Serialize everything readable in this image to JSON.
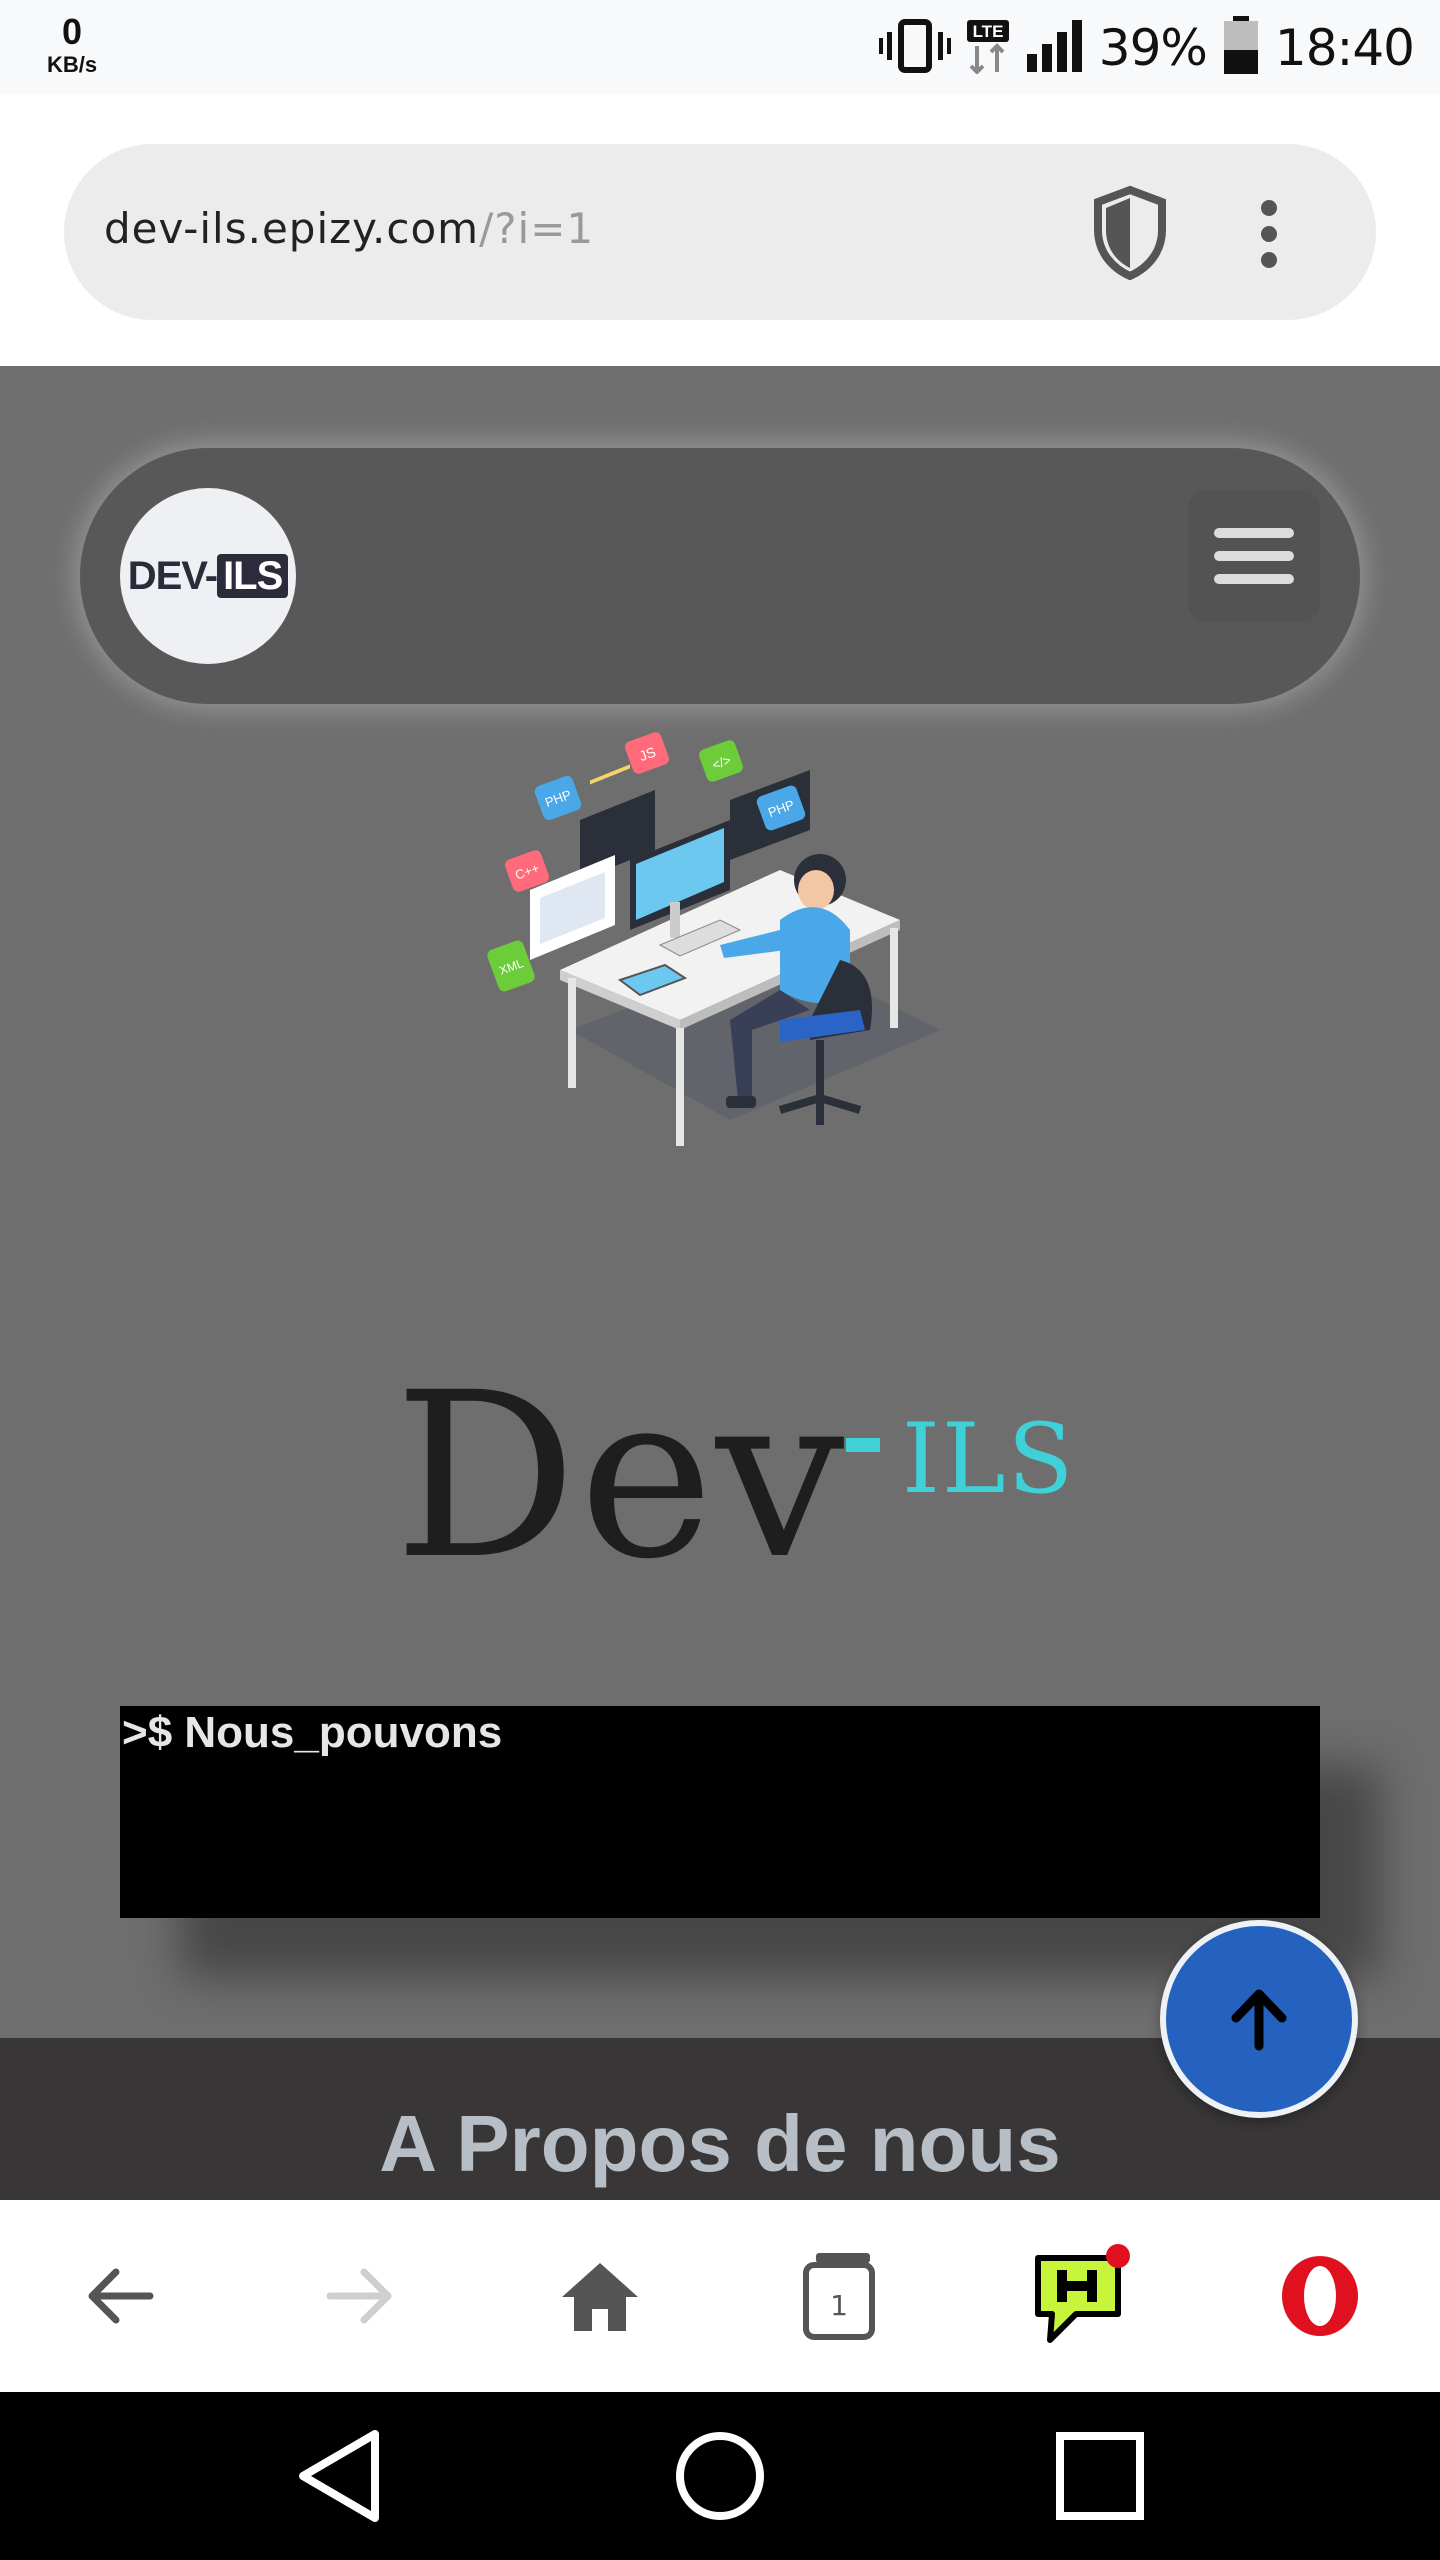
{
  "status_bar": {
    "net_speed": "0",
    "net_unit": "KB/s",
    "network_type": "LTE",
    "battery": "39%",
    "time": "18:40"
  },
  "browser": {
    "url_host": "dev-ils.epizy.com",
    "url_query": "/?i=1",
    "tab_count": "1"
  },
  "site": {
    "logo_text_1": "DEV-",
    "logo_text_2": "ILS",
    "illustration_tags": [
      "JS",
      "PHP",
      "</>",
      "PHP",
      "C++",
      "XML"
    ],
    "hero_main": "Dev",
    "hero_accent": "ILS",
    "terminal_line": ">$ Nous_pouvons",
    "about_title": "A Propos de nous"
  },
  "colors": {
    "page_bg": "#6e6e6e",
    "nav_bg": "#585858",
    "accent": "#3fd0d8",
    "fab": "#2561bf",
    "about_bg": "#383636",
    "opera_red": "#e0101e"
  }
}
